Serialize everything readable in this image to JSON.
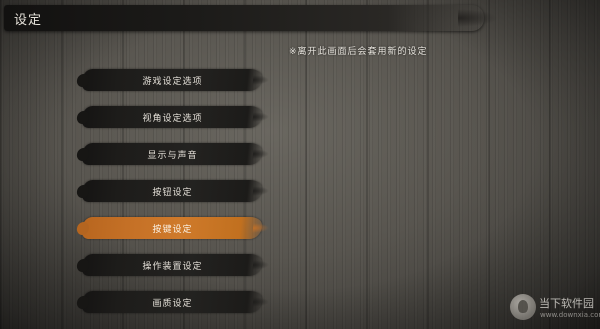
{
  "header": {
    "title": "设定"
  },
  "notice": "※离开此画面后会套用新的设定",
  "menu": {
    "items": [
      {
        "label": "游戏设定选项"
      },
      {
        "label": "视角设定选项"
      },
      {
        "label": "显示与声音"
      },
      {
        "label": "按钮设定"
      },
      {
        "label": "按键设定"
      },
      {
        "label": "操作装置设定"
      },
      {
        "label": "画质设定"
      }
    ],
    "selected_index": 4
  },
  "watermark": {
    "brand": "当下软件园",
    "url": "www.downxia.com"
  },
  "colors": {
    "accent": "#c47026",
    "stroke": "#1d1c1a",
    "text": "#e4e0d8"
  }
}
